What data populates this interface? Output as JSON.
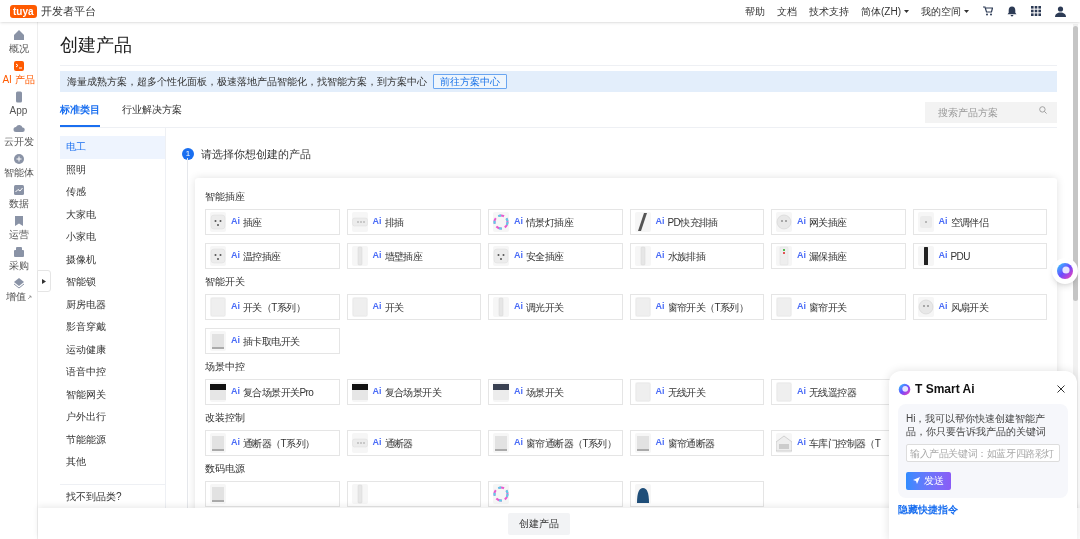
{
  "topbar": {
    "logo": "tuya",
    "brand": "开发者平台",
    "nav": [
      {
        "label": "帮助",
        "dropdown": false
      },
      {
        "label": "文档",
        "dropdown": false
      },
      {
        "label": "技术支持",
        "dropdown": false
      },
      {
        "label": "简体(ZH)",
        "dropdown": true
      },
      {
        "label": "我的空间",
        "dropdown": true
      }
    ]
  },
  "rail": [
    {
      "label": "概况",
      "selected": false,
      "external": false
    },
    {
      "label": "AI 产品",
      "selected": true,
      "external": false
    },
    {
      "label": "App",
      "selected": false,
      "external": false
    },
    {
      "label": "云开发",
      "selected": false,
      "external": false
    },
    {
      "label": "智能体",
      "selected": false,
      "external": false
    },
    {
      "label": "数据",
      "selected": false,
      "external": false
    },
    {
      "label": "运营",
      "selected": false,
      "external": false
    },
    {
      "label": "采购",
      "selected": false,
      "external": false
    },
    {
      "label": "增值",
      "selected": false,
      "external": true
    }
  ],
  "page_title": "创建产品",
  "banner": {
    "text": "海量成熟方案，超多个性化面板，极速落地产品智能化，找智能方案，到方案中心",
    "button": "前往方案中心"
  },
  "tabs": [
    {
      "label": "标准类目",
      "selected": true
    },
    {
      "label": "行业解决方案",
      "selected": false
    }
  ],
  "search": {
    "placeholder": "搜索产品方案"
  },
  "categories": [
    {
      "label": "电工",
      "selected": true
    },
    {
      "label": "照明",
      "selected": false
    },
    {
      "label": "传感",
      "selected": false
    },
    {
      "label": "大家电",
      "selected": false
    },
    {
      "label": "小家电",
      "selected": false
    },
    {
      "label": "摄像机",
      "selected": false
    },
    {
      "label": "智能锁",
      "selected": false
    },
    {
      "label": "厨房电器",
      "selected": false
    },
    {
      "label": "影音穿戴",
      "selected": false
    },
    {
      "label": "运动健康",
      "selected": false
    },
    {
      "label": "语音中控",
      "selected": false
    },
    {
      "label": "智能网关",
      "selected": false
    },
    {
      "label": "户外出行",
      "selected": false
    },
    {
      "label": "节能能源",
      "selected": false
    },
    {
      "label": "其他",
      "selected": false
    }
  ],
  "category_footer": "找不到品类?",
  "step": {
    "number": "1",
    "text": "请选择你想创建的产品"
  },
  "groups": [
    {
      "title": "智能插座",
      "products": [
        {
          "kind": "socket",
          "badge": "Ai",
          "label": "插座"
        },
        {
          "kind": "strip",
          "badge": "Ai",
          "label": "排插"
        },
        {
          "kind": "ring",
          "badge": "Ai",
          "label": "情景灯插座"
        },
        {
          "kind": "dark-strip",
          "badge": "Ai",
          "label": "PD快充排插"
        },
        {
          "kind": "round",
          "badge": "Ai",
          "label": "网关插座"
        },
        {
          "kind": "small",
          "badge": "Ai",
          "label": "空调伴侣"
        },
        {
          "kind": "socket",
          "badge": "Ai",
          "label": "温控插座"
        },
        {
          "kind": "slim",
          "badge": "Ai",
          "label": "墙壁插座"
        },
        {
          "kind": "socket",
          "badge": "Ai",
          "label": "安全插座"
        },
        {
          "kind": "slim",
          "badge": "Ai",
          "label": "水族排插"
        },
        {
          "kind": "indicator",
          "badge": "Ai",
          "label": "漏保插座"
        },
        {
          "kind": "black-bar",
          "badge": "Ai",
          "label": "PDU"
        }
      ]
    },
    {
      "title": "智能开关",
      "products": [
        {
          "kind": "panel",
          "badge": "Ai",
          "label": "开关（T系列）"
        },
        {
          "kind": "panel",
          "badge": "Ai",
          "label": "开关"
        },
        {
          "kind": "slim",
          "badge": "Ai",
          "label": "调光开关"
        },
        {
          "kind": "panel",
          "badge": "Ai",
          "label": "窗帘开关（T系列）"
        },
        {
          "kind": "panel",
          "badge": "Ai",
          "label": "窗帘开关"
        },
        {
          "kind": "round",
          "badge": "Ai",
          "label": "风扇开关"
        },
        {
          "kind": "box",
          "badge": "Ai",
          "label": "插卡取电开关"
        }
      ]
    },
    {
      "title": "场景中控",
      "products": [
        {
          "kind": "panel-black",
          "badge": "Ai",
          "label": "复合场景开关Pro"
        },
        {
          "kind": "panel-black",
          "badge": "Ai",
          "label": "复合场景开关"
        },
        {
          "kind": "panel-dark",
          "badge": "Ai",
          "label": "场景开关"
        },
        {
          "kind": "panel",
          "badge": "Ai",
          "label": "无线开关"
        },
        {
          "kind": "panel",
          "badge": "Ai",
          "label": "无线遥控器"
        }
      ]
    },
    {
      "title": "改装控制",
      "products": [
        {
          "kind": "box",
          "badge": "Ai",
          "label": "通断器（T系列）"
        },
        {
          "kind": "strip",
          "badge": "Ai",
          "label": "通断器"
        },
        {
          "kind": "box",
          "badge": "Ai",
          "label": "窗帘通断器（T系列）"
        },
        {
          "kind": "box",
          "badge": "Ai",
          "label": "窗帘通断器"
        },
        {
          "kind": "garage",
          "badge": "Ai",
          "label": "车库门控制器（T"
        }
      ]
    },
    {
      "title": "数码电源",
      "products": [
        {
          "kind": "box"
        },
        {
          "kind": "slim"
        },
        {
          "kind": "ring"
        },
        {
          "kind": "hood"
        }
      ]
    }
  ],
  "footer_button": "创建产品",
  "chat": {
    "title": "T Smart Ai",
    "message": "Hi，我可以帮你快速创建智能产品，你只要告诉我产品的关键词",
    "placeholder": "输入产品关键词：如蓝牙四路彩灯",
    "send": "发送",
    "hide_link": "隐藏快捷指令"
  }
}
